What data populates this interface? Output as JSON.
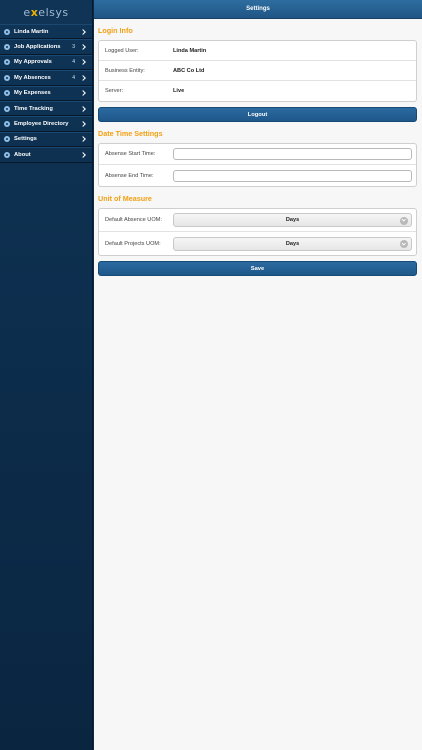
{
  "brand": {
    "logo_prefix": "e",
    "logo_x": "x",
    "logo_suffix": "elsys"
  },
  "sidebar": {
    "items": [
      {
        "label": "Linda Martin",
        "count": ""
      },
      {
        "label": "Job Applications",
        "count": "3"
      },
      {
        "label": "My Approvals",
        "count": "4"
      },
      {
        "label": "My Absences",
        "count": "4"
      },
      {
        "label": "My Expenses",
        "count": ""
      },
      {
        "label": "Time Tracking",
        "count": ""
      },
      {
        "label": "Employee Directory",
        "count": ""
      },
      {
        "label": "Settings",
        "count": ""
      },
      {
        "label": "About",
        "count": ""
      }
    ]
  },
  "header": {
    "title": "Settings"
  },
  "login_info": {
    "title": "Login Info",
    "logged_user_label": "Logged User:",
    "logged_user_value": "Linda Martin",
    "business_entity_label": "Business Entity:",
    "business_entity_value": "ABC Co Ltd",
    "server_label": "Server:",
    "server_value": "Live",
    "logout_label": "Logout"
  },
  "date_time": {
    "title": "Date Time Settings",
    "start_label": "Absense Start Time:",
    "start_value": "",
    "end_label": "Absense End Time:",
    "end_value": ""
  },
  "uom": {
    "title": "Unit of Measure",
    "absence_label": "Default Absence UOM:",
    "absence_value": "Days",
    "projects_label": "Default Projects UOM:",
    "projects_value": "Days"
  },
  "actions": {
    "save_label": "Save"
  },
  "colors": {
    "accent": "#f0a013",
    "button": "#1f578a",
    "sidebar": "#0f3456"
  }
}
